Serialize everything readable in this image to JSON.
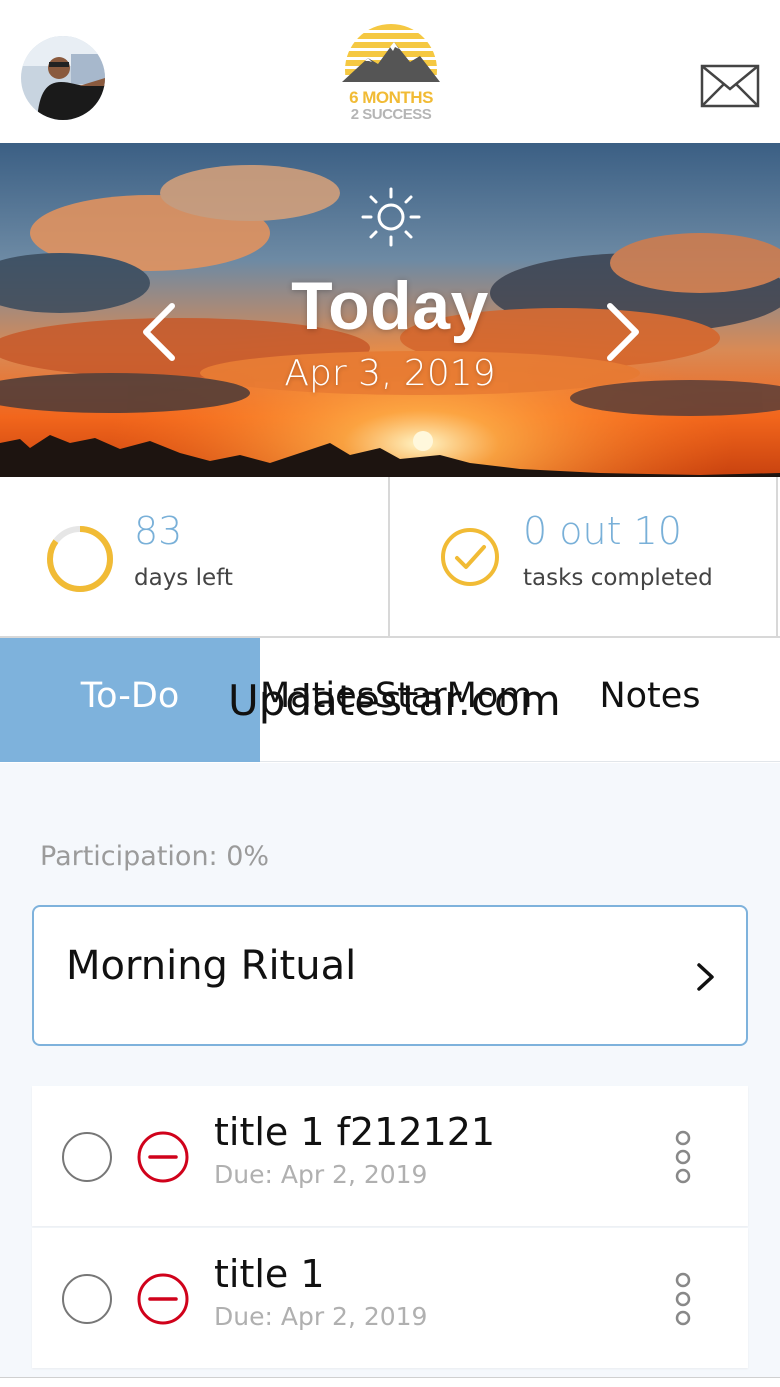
{
  "header": {
    "avatar_icon": "user-avatar",
    "logo": {
      "line1": "6 MONTHS",
      "line2": "2 SUCCESS"
    },
    "mail_icon": "envelope-icon"
  },
  "hero": {
    "weather_icon": "sun-icon",
    "title": "Today",
    "date": "Apr 3, 2019",
    "prev_icon": "chevron-left-icon",
    "next_icon": "chevron-right-icon"
  },
  "stats": {
    "days": {
      "value": "83",
      "label": "days left",
      "progress": 0.85,
      "color": "#f1bb35"
    },
    "tasks": {
      "value": "0 out 10",
      "label": "tasks completed",
      "color": "#f1bb35"
    }
  },
  "tabs": [
    {
      "label": "To-Do",
      "active": true
    },
    {
      "label": "MatiesStarMom",
      "active": false
    },
    {
      "label": "Notes",
      "active": false
    }
  ],
  "watermark": "Updatestar.com",
  "participation": "Participation: 0%",
  "ritual": {
    "title": "Morning Ritual"
  },
  "tasks": [
    {
      "title": "title 1 f212121",
      "due": "Due: Apr 2, 2019"
    },
    {
      "title": "title 1",
      "due": "Due: Apr 2, 2019"
    }
  ],
  "colors": {
    "accent_blue": "#7eb2dc",
    "stat_blue": "#79b0d8",
    "ring_yellow": "#f1bb35",
    "remove_red": "#d0021b"
  }
}
